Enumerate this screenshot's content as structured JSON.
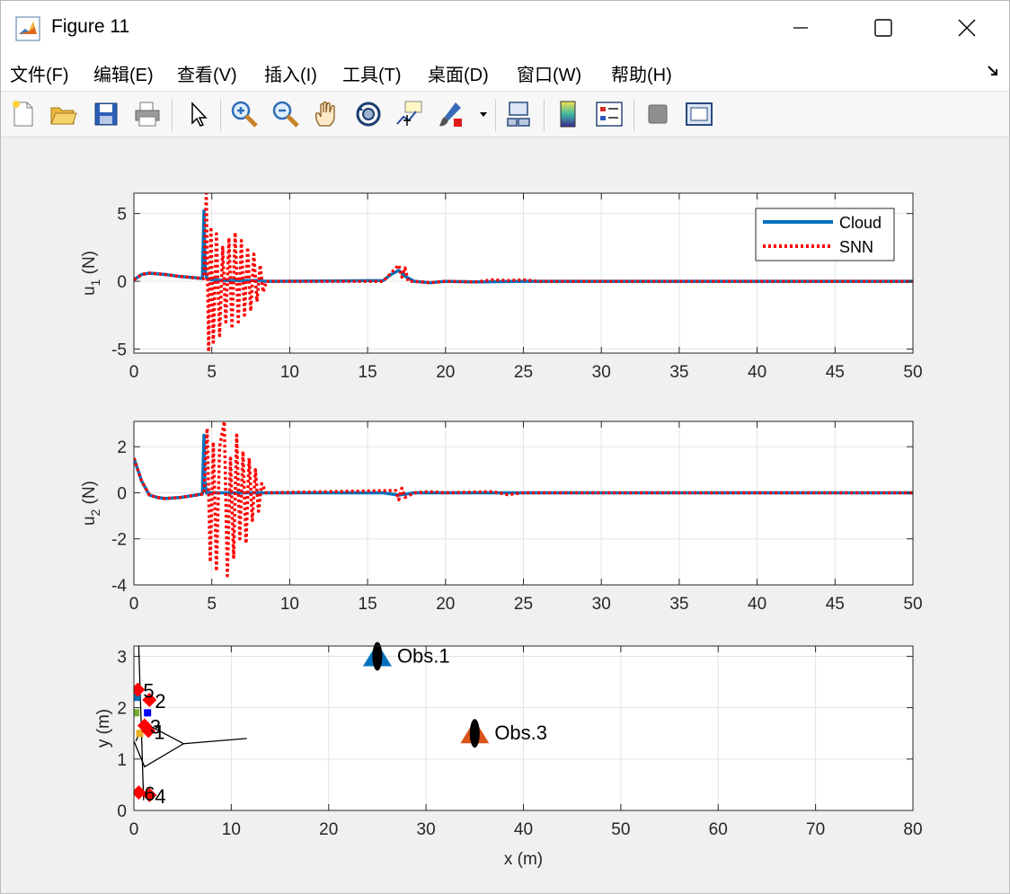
{
  "window": {
    "title": "Figure 11",
    "minimize_glyph": "—",
    "close_glyph": "✕"
  },
  "menu": [
    "文件(F)",
    "编辑(E)",
    "查看(V)",
    "插入(I)",
    "工具(T)",
    "桌面(D)",
    "窗口(W)",
    "帮助(H)"
  ],
  "toolbar": [
    "new-figure-icon",
    "open-file-icon",
    "save-icon",
    "print-icon",
    "pointer-icon",
    "zoom-in-icon",
    "zoom-out-icon",
    "pan-hand-icon",
    "rotate-3d-icon",
    "data-cursor-icon",
    "brush-icon",
    "link-plot-icon",
    "colorbar-icon",
    "legend-icon",
    "hide-plot-tools-icon",
    "show-plot-tools-icon"
  ],
  "colors": {
    "cloud": "#0072bd",
    "snn": "#ff0000",
    "obs1": "#0072bd",
    "obs3": "#d95319"
  },
  "chart_data": [
    {
      "type": "line",
      "ylabel": "u_1 (N)",
      "ylabel_main": "u",
      "ylabel_sub": "1",
      "ylabel_unit": " (N)",
      "xlim": [
        0,
        50
      ],
      "ylim": [
        -5.3,
        6.5
      ],
      "xticks": [
        0,
        5,
        10,
        15,
        20,
        25,
        30,
        35,
        40,
        45,
        50
      ],
      "yticks": [
        -5,
        0,
        5
      ],
      "grid": true,
      "legend": {
        "placement": "top-right",
        "entries": [
          "Cloud",
          "SNN"
        ]
      },
      "series": [
        {
          "name": "Cloud",
          "style": "solid",
          "x": [
            0,
            0.5,
            1,
            1.5,
            2,
            3,
            4,
            4.4,
            4.5,
            4.55,
            4.6,
            4.7,
            5,
            6,
            7,
            8,
            8.5,
            16,
            16.5,
            17,
            17.5,
            18,
            19,
            20,
            22,
            25,
            30,
            40,
            50
          ],
          "y": [
            0.1,
            0.5,
            0.6,
            0.55,
            0.5,
            0.35,
            0.25,
            0.2,
            5.2,
            2.0,
            0.6,
            0.2,
            0.1,
            0.05,
            0.05,
            0.05,
            0.0,
            0.05,
            0.5,
            0.8,
            0.3,
            0.0,
            -0.1,
            0.0,
            -0.05,
            0.0,
            0.0,
            0.0,
            0.0
          ]
        },
        {
          "name": "SNN",
          "style": "dotted",
          "x": [
            0,
            0.5,
            1,
            2,
            3,
            4,
            4.5,
            4.65,
            4.8,
            4.95,
            5.1,
            5.3,
            5.5,
            5.7,
            5.9,
            6.1,
            6.3,
            6.5,
            6.7,
            6.9,
            7.1,
            7.3,
            7.5,
            7.7,
            7.9,
            8.1,
            8.3,
            8.5,
            16,
            16.5,
            17,
            17.2,
            17.4,
            17.6,
            18,
            19,
            20,
            22,
            23,
            24,
            25,
            26,
            30,
            40,
            50
          ],
          "y": [
            0.1,
            0.5,
            0.6,
            0.5,
            0.35,
            0.25,
            0.2,
            6.5,
            -5.2,
            4.0,
            -4.5,
            3.5,
            -4.0,
            2.5,
            -3.0,
            3.2,
            -3.5,
            3.6,
            -3.0,
            3.0,
            -2.5,
            2.5,
            -2.2,
            2.0,
            -1.5,
            1.2,
            -0.8,
            0.0,
            0.0,
            0.6,
            1.2,
            0.3,
            1.0,
            0.0,
            0.0,
            -0.1,
            0.0,
            -0.05,
            0.1,
            0.05,
            0.1,
            0.0,
            0.0,
            0.0,
            0.0
          ]
        }
      ]
    },
    {
      "type": "line",
      "ylabel": "u_2 (N)",
      "ylabel_main": "u",
      "ylabel_sub": "2",
      "ylabel_unit": " (N)",
      "xlim": [
        0,
        50
      ],
      "ylim": [
        -4,
        3.1
      ],
      "xticks": [
        0,
        5,
        10,
        15,
        20,
        25,
        30,
        35,
        40,
        45,
        50
      ],
      "yticks": [
        -4,
        -2,
        0,
        2
      ],
      "grid": true,
      "series": [
        {
          "name": "Cloud",
          "style": "solid",
          "x": [
            0,
            0.5,
            1,
            1.5,
            2,
            3,
            4,
            4.4,
            4.5,
            4.55,
            4.65,
            5,
            6,
            8,
            8.5,
            16,
            17,
            18,
            20,
            50
          ],
          "y": [
            1.5,
            0.5,
            -0.1,
            -0.2,
            -0.25,
            -0.2,
            -0.1,
            -0.05,
            2.5,
            0.5,
            0.0,
            0.0,
            0.0,
            0.0,
            0.0,
            0.0,
            -0.1,
            0.0,
            0.0,
            0.0
          ]
        },
        {
          "name": "SNN",
          "style": "dotted",
          "x": [
            0,
            0.5,
            1,
            1.5,
            2,
            3,
            4,
            4.5,
            4.7,
            4.9,
            5.1,
            5.3,
            5.5,
            5.8,
            6.0,
            6.2,
            6.4,
            6.6,
            6.8,
            7.0,
            7.2,
            7.4,
            7.6,
            7.8,
            8.0,
            8.2,
            8.5,
            16.8,
            17.0,
            17.2,
            17.4,
            18,
            19,
            20,
            23,
            24,
            25,
            26,
            50
          ],
          "y": [
            1.5,
            0.5,
            -0.1,
            -0.2,
            -0.25,
            -0.2,
            -0.1,
            -0.05,
            2.8,
            -3.0,
            2.2,
            -3.4,
            2.0,
            3.1,
            -3.6,
            1.5,
            -2.8,
            2.5,
            -2.0,
            1.8,
            -2.2,
            1.5,
            -1.2,
            1.0,
            -0.8,
            0.4,
            0.0,
            0.1,
            -0.3,
            0.2,
            -0.2,
            0.0,
            0.05,
            0.0,
            0.05,
            -0.08,
            0.0,
            0.0,
            0.0
          ]
        }
      ]
    },
    {
      "type": "scatter",
      "xlabel": "x (m)",
      "ylabel": "y (m)",
      "xlim": [
        0,
        80
      ],
      "ylim": [
        0,
        3.2
      ],
      "xticks": [
        0,
        10,
        20,
        30,
        40,
        50,
        60,
        70,
        80
      ],
      "yticks": [
        0,
        1,
        2,
        3
      ],
      "grid": true,
      "obstacles": [
        {
          "label": "Obs.1",
          "x": 25,
          "y": 3.0,
          "color": "#0072bd"
        },
        {
          "label": "Obs.3",
          "x": 35,
          "y": 1.5,
          "color": "#d95319"
        }
      ],
      "agents": [
        {
          "label": "5",
          "x": 0.4,
          "y": 2.35
        },
        {
          "label": "2",
          "x": 1.6,
          "y": 2.15
        },
        {
          "label": "3",
          "x": 1.1,
          "y": 1.65
        },
        {
          "label": "1",
          "x": 1.5,
          "y": 1.55
        },
        {
          "label": "6",
          "x": 0.5,
          "y": 0.35
        },
        {
          "label": "4",
          "x": 1.6,
          "y": 0.3
        }
      ],
      "small_markers": [
        {
          "x": 0.2,
          "y": 1.9,
          "color": "#77ac30"
        },
        {
          "x": 0.3,
          "y": 2.2,
          "color": "#0072bd"
        },
        {
          "x": 1.4,
          "y": 1.9,
          "color": "#0000ff"
        },
        {
          "x": 0.6,
          "y": 1.5,
          "color": "#edb120"
        }
      ],
      "lines": [
        {
          "x": [
            0.5,
            1.0
          ],
          "y": [
            3.2,
            0.2
          ]
        },
        {
          "x": [
            0,
            1.1,
            5.1,
            11.6
          ],
          "y": [
            1.35,
            0.85,
            1.3,
            1.4
          ]
        },
        {
          "x": [
            0.2,
            1.1,
            5.1
          ],
          "y": [
            1.35,
            1.7,
            1.3
          ]
        }
      ]
    }
  ]
}
